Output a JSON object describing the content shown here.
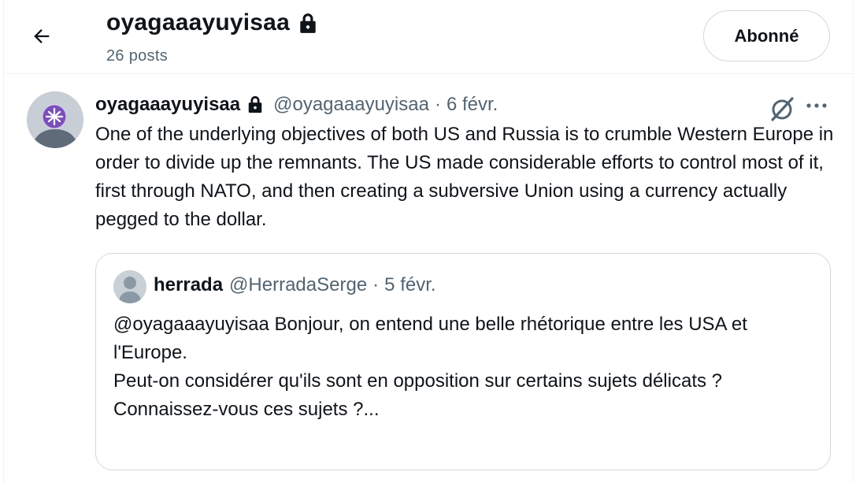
{
  "header": {
    "title": "oyagaaayuyisaa",
    "post_count": "26 posts",
    "follow_label": "Abonné"
  },
  "post": {
    "author_name": "oyagaaayuyisaa",
    "author_handle": "@oyagaaayuyisaa",
    "separator": "·",
    "date": "6 févr.",
    "text": "One of the underlying objectives of both US and Russia is to crumble Western Europe in order to divide up the remnants. The US made considerable efforts to control most of it, first through NATO, and then creating a subversive Union using a currency actually pegged to the dollar."
  },
  "quote": {
    "author_name": "herrada",
    "author_handle": "@HerradaSerge",
    "separator": "·",
    "date": "5 févr.",
    "lines": [
      "@oyagaaayuyisaa Bonjour, on entend une belle rhétorique entre les USA et l'Europe.",
      "Peut-on considérer qu'ils sont en opposition sur certains sujets délicats ?",
      "Connaissez-vous ces sujets ?..."
    ]
  },
  "icons": {
    "back": "arrow-left-icon",
    "lock": "lock-icon",
    "grok": "grok-icon",
    "more": "more-icon"
  },
  "colors": {
    "text": "#0f1419",
    "secondary": "#536471",
    "border": "#cfd9de"
  }
}
